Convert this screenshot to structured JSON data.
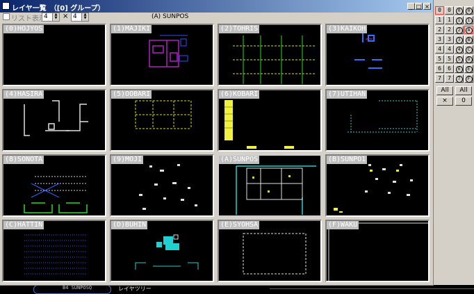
{
  "window": {
    "title": "レイヤ一覧　（[0] グループ）",
    "minimize": "_",
    "maximize": "□",
    "close": "×"
  },
  "toolbar": {
    "list_view_label": "リスト表示",
    "cols_value": "4",
    "rows_value": "4",
    "times": "×",
    "current_layer": "(A) SUNPOS"
  },
  "layers": [
    {
      "label": "(0)HOJYOS"
    },
    {
      "label": "(1)MAJIKI"
    },
    {
      "label": "(2)TOHRIS"
    },
    {
      "label": "(3)KAIKOH"
    },
    {
      "label": "(4)HASIRA"
    },
    {
      "label": "(5)OOBARI"
    },
    {
      "label": "(6)KOBARI"
    },
    {
      "label": "(7)UTIHAN"
    },
    {
      "label": "(8)SONOTA"
    },
    {
      "label": "(9)MOJI"
    },
    {
      "label": "(A)SUNPOS"
    },
    {
      "label": "(B)SUNPO1"
    },
    {
      "label": "(C)HATTIN"
    },
    {
      "label": "(D)BUHIN"
    },
    {
      "label": "(E)SYOHSA"
    },
    {
      "label": "(F)WAKU"
    }
  ],
  "palette": {
    "rows": [
      [
        "0",
        "0",
        "0"
      ],
      [
        "1",
        "1",
        "1"
      ],
      [
        "2",
        "2",
        "A"
      ],
      [
        "3",
        "3",
        "B"
      ],
      [
        "4",
        "4",
        "C"
      ],
      [
        "5",
        "5",
        "D"
      ],
      [
        "6",
        "6",
        "E"
      ],
      [
        "7",
        "7",
        "F"
      ]
    ],
    "all_left": "All",
    "all_right": "All",
    "clear": "×",
    "zero": "0"
  },
  "background": {
    "status_text": "レイヤツリー",
    "blue_text": "B4  SUNPOSQ"
  },
  "colors": {
    "title_start": "#0a246a",
    "title_end": "#a6caf0",
    "face": "#d4d0c8",
    "accent_red": "#e04040"
  }
}
